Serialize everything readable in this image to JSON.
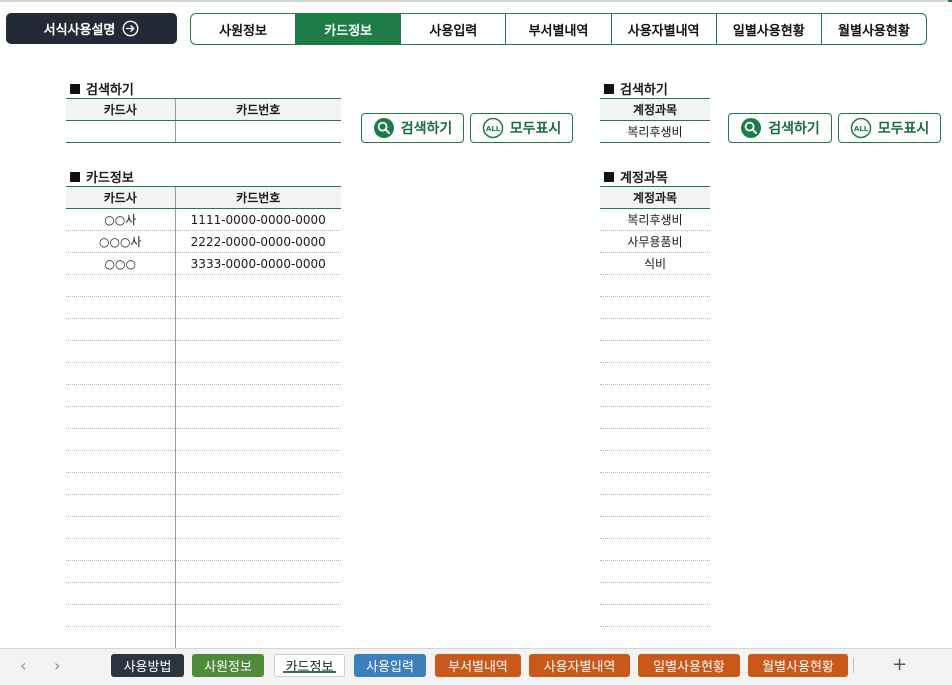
{
  "guide_button": {
    "label": "서식사용설명"
  },
  "nav_tabs": [
    {
      "label": "사원정보",
      "active": false
    },
    {
      "label": "카드정보",
      "active": true
    },
    {
      "label": "사용입력",
      "active": false
    },
    {
      "label": "부서별내역",
      "active": false
    },
    {
      "label": "사용자별내역",
      "active": false
    },
    {
      "label": "일별사용현황",
      "active": false
    },
    {
      "label": "월별사용현황",
      "active": false
    }
  ],
  "card_search": {
    "title": "검색하기",
    "headers": [
      "카드사",
      "카드번호"
    ],
    "values": [
      "",
      ""
    ]
  },
  "account_search": {
    "title": "검색하기",
    "header": "계정과목",
    "value": "복리후생비"
  },
  "buttons": {
    "search": "검색하기",
    "show_all": "모두표시",
    "all_icon_text": "ALL"
  },
  "card_info": {
    "title": "카드정보",
    "headers": [
      "카드사",
      "카드번호"
    ],
    "rows": [
      [
        "○○사",
        "1111-0000-0000-0000"
      ],
      [
        "○○○사",
        "2222-0000-0000-0000"
      ],
      [
        "○○○",
        "3333-0000-0000-0000"
      ]
    ]
  },
  "account_info": {
    "title": "계정과목",
    "header": "계정과목",
    "rows": [
      "복리후생비",
      "사무용품비",
      "식비"
    ]
  },
  "sheet_tabs": [
    {
      "label": "사용방법",
      "style": "dark"
    },
    {
      "label": "사원정보",
      "style": "green"
    },
    {
      "label": "카드정보",
      "style": "current"
    },
    {
      "label": "사용입력",
      "style": "blue"
    },
    {
      "label": "부서별내역",
      "style": "orange"
    },
    {
      "label": "사용자별내역",
      "style": "orange"
    },
    {
      "label": "일별사용현황",
      "style": "orange"
    },
    {
      "label": "월별사용현황",
      "style": "orange"
    }
  ],
  "colors": {
    "brand_green": "#1e7c46",
    "dark": "#232935",
    "orange": "#c9591a",
    "blue": "#3d7fbd"
  },
  "icons": [
    "arrow-right-circle-icon",
    "search-icon",
    "all-icon",
    "chevron-left-icon",
    "chevron-right-icon",
    "plus-icon"
  ]
}
